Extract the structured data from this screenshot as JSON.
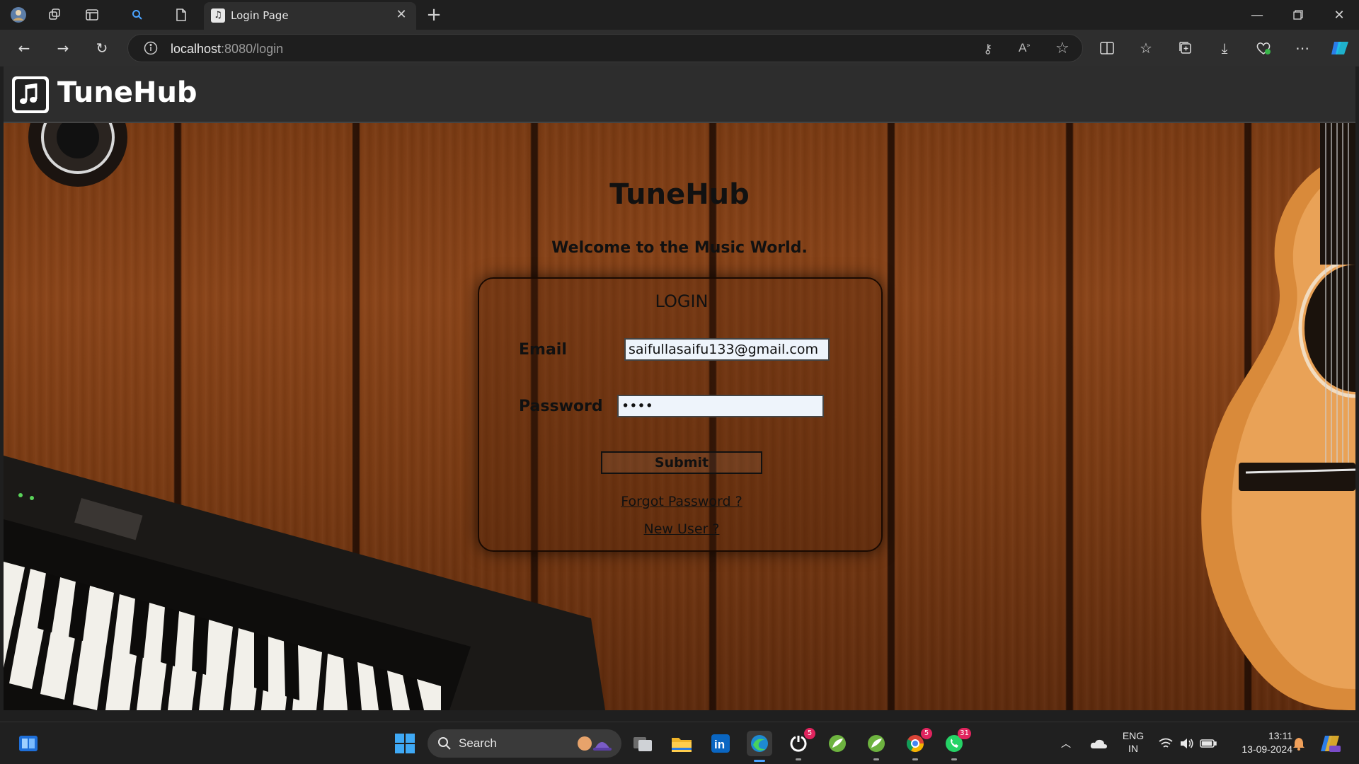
{
  "browser": {
    "tab_title": "Login Page",
    "url_host": "localhost",
    "url_rest": ":8080/login",
    "accent_color": "#2b7de9"
  },
  "app": {
    "brand": "TuneHub",
    "logo_icon": "music-note-icon"
  },
  "hero": {
    "title": "TuneHub",
    "subtitle": "Welcome to the Music World."
  },
  "login": {
    "title": "LOGIN",
    "email_label": "Email",
    "email_value": "saifullasaifu133@gmail.com",
    "password_label": "Password",
    "password_value": "••••",
    "submit_label": "Submit",
    "forgot_link": "Forgot Password ?",
    "new_user_link": "New User ?"
  },
  "taskbar": {
    "search_label": "Search",
    "lang_line1": "ENG",
    "lang_line2": "IN",
    "time": "13:11",
    "date": "13-09-2024",
    "badges": {
      "copilot": "5",
      "chrome": "5",
      "whatsapp": "31"
    }
  }
}
